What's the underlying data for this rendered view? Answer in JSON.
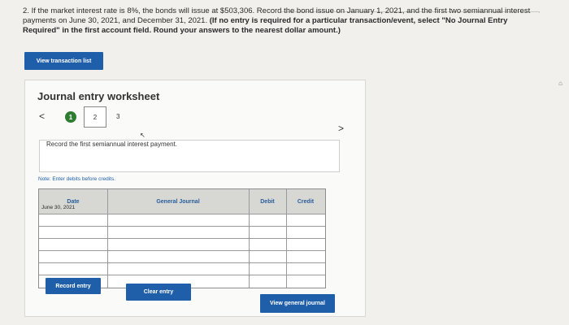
{
  "question": {
    "number": "2.",
    "text_part1": "If the market interest rate is 8%, the bonds will issue at $503,306. Record the bond issue on January 1, 2021, and the first two semiannual interest payments on June 30, 2021, and December 31, 2021.",
    "text_bold": "(If no entry is required for a particular transaction/event, select \"No Journal Entry Required\" in the first account field. Round your answers to the nearest dollar amount.)"
  },
  "buttons": {
    "view_transaction_list": "View transaction list",
    "record_entry": "Record entry",
    "clear_entry": "Clear entry",
    "view_general_journal": "View general journal"
  },
  "worksheet": {
    "title": "Journal entry worksheet",
    "steps": [
      "1",
      "2",
      "3"
    ],
    "instruction": "Record the first semiannual interest payment.",
    "note": "Note: Enter debits before credits.",
    "columns": {
      "date": "Date",
      "general_journal": "General Journal",
      "debit": "Debit",
      "credit": "Credit"
    },
    "rows": [
      {
        "date": "June 30, 2021"
      },
      {
        "date": ""
      },
      {
        "date": ""
      },
      {
        "date": ""
      },
      {
        "date": ""
      },
      {
        "date": ""
      }
    ]
  },
  "colors": {
    "accent": "#1f5fa9",
    "step_done": "#2e7d32"
  }
}
